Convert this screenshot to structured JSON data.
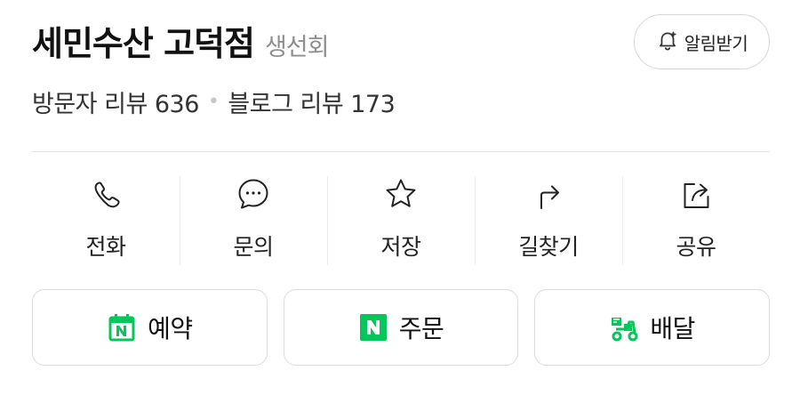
{
  "header": {
    "store_name": "세민수산 고덕점",
    "category": "생선회",
    "alarm_label": "알림받기"
  },
  "reviews": {
    "visitor_label": "방문자 리뷰 636",
    "separator": "•",
    "blog_label": "블로그 리뷰 173"
  },
  "actions": [
    {
      "label": "전화",
      "icon": "phone-icon"
    },
    {
      "label": "문의",
      "icon": "chat-bubble-icon"
    },
    {
      "label": "저장",
      "icon": "star-icon"
    },
    {
      "label": "길찾기",
      "icon": "directions-arrow-icon"
    },
    {
      "label": "공유",
      "icon": "share-icon"
    }
  ],
  "buttons": [
    {
      "label": "예약",
      "icon": "naver-calendar-icon"
    },
    {
      "label": "주문",
      "icon": "naver-n-icon"
    },
    {
      "label": "배달",
      "icon": "delivery-scooter-icon"
    }
  ],
  "colors": {
    "brand_green": "#03c75a",
    "text": "#111111",
    "muted": "#8e8e8e",
    "border": "#dcdcdc"
  }
}
